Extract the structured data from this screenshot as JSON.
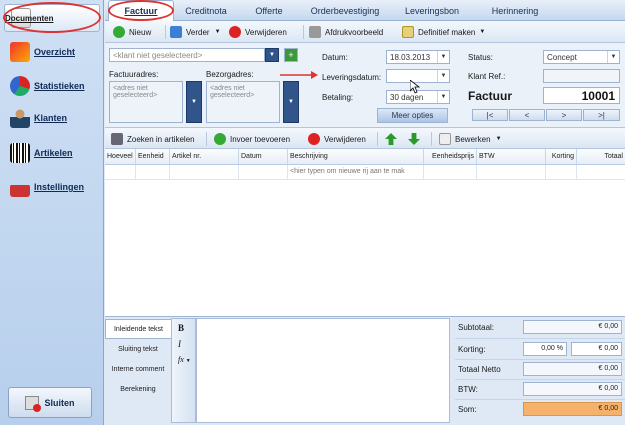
{
  "sidebar": {
    "items": [
      {
        "label": "Documenten"
      },
      {
        "label": "Overzicht"
      },
      {
        "label": "Statistieken"
      },
      {
        "label": "Klanten"
      },
      {
        "label": "Artikelen"
      },
      {
        "label": "Instellingen"
      }
    ],
    "close_label": "Sluiten"
  },
  "tabs": [
    "Factuur",
    "Creditnota",
    "Offerte",
    "Orderbevestiging",
    "Leveringsbon",
    "Herinnering"
  ],
  "toolbar": {
    "new": "Nieuw",
    "next": "Verder",
    "delete": "Verwijderen",
    "print_preview": "Afdrukvoorbeeld",
    "finalize": "Definitief maken"
  },
  "form": {
    "customer_placeholder": "<klant niet geselecteerd>",
    "invoice_address_label": "Factuuradres:",
    "delivery_address_label": "Bezorgadres:",
    "address_placeholder": "<adres niet geselecteerd>",
    "date_label": "Datum:",
    "date_value": "18.03.2013",
    "delivery_date_label": "Leveringsdatum:",
    "delivery_date_value": "",
    "payment_label": "Betaling:",
    "payment_value": "30 dagen",
    "more_options": "Meer opties",
    "status_label": "Status:",
    "status_value": "Concept",
    "client_ref_label": "Klant Ref.:",
    "client_ref_value": "",
    "doc_title": "Factuur",
    "doc_number": "10001",
    "nav": [
      "|<",
      "<",
      ">",
      ">|"
    ]
  },
  "itembar": {
    "search": "Zoeken in artikelen",
    "add": "Invoer toevoeren",
    "delete": "Verwijderen",
    "edit": "Bewerken"
  },
  "grid": {
    "columns": [
      "Hoeveel",
      "Eenheid",
      "Artikel nr.",
      "Datum",
      "Beschrijving",
      "Eenheidsprijs",
      "BTW",
      "Korting",
      "Totaal"
    ],
    "new_row_hint": "<hier typen om nieuwe rij aan te mak"
  },
  "bottom_tabs": [
    "Inleidende tekst",
    "Sluiting tekst",
    "Interne comment",
    "Berekening"
  ],
  "format": {
    "bold": "B",
    "italic": "I",
    "fx": "fx"
  },
  "totals": {
    "subtotal_label": "Subtotaal:",
    "subtotal": "€ 0,00",
    "discount_label": "Korting:",
    "discount_pct": "0,00 %",
    "discount": "€ 0,00",
    "net_label": "Totaal Netto",
    "net": "€ 0,00",
    "vat_label": "BTW:",
    "vat": "€ 0,00",
    "sum_label": "Som:",
    "sum": "€ 0,00"
  },
  "colors": {
    "accent": "#31558a",
    "sum_highlight": "#f6b26b",
    "annotation": "#dd3333"
  }
}
